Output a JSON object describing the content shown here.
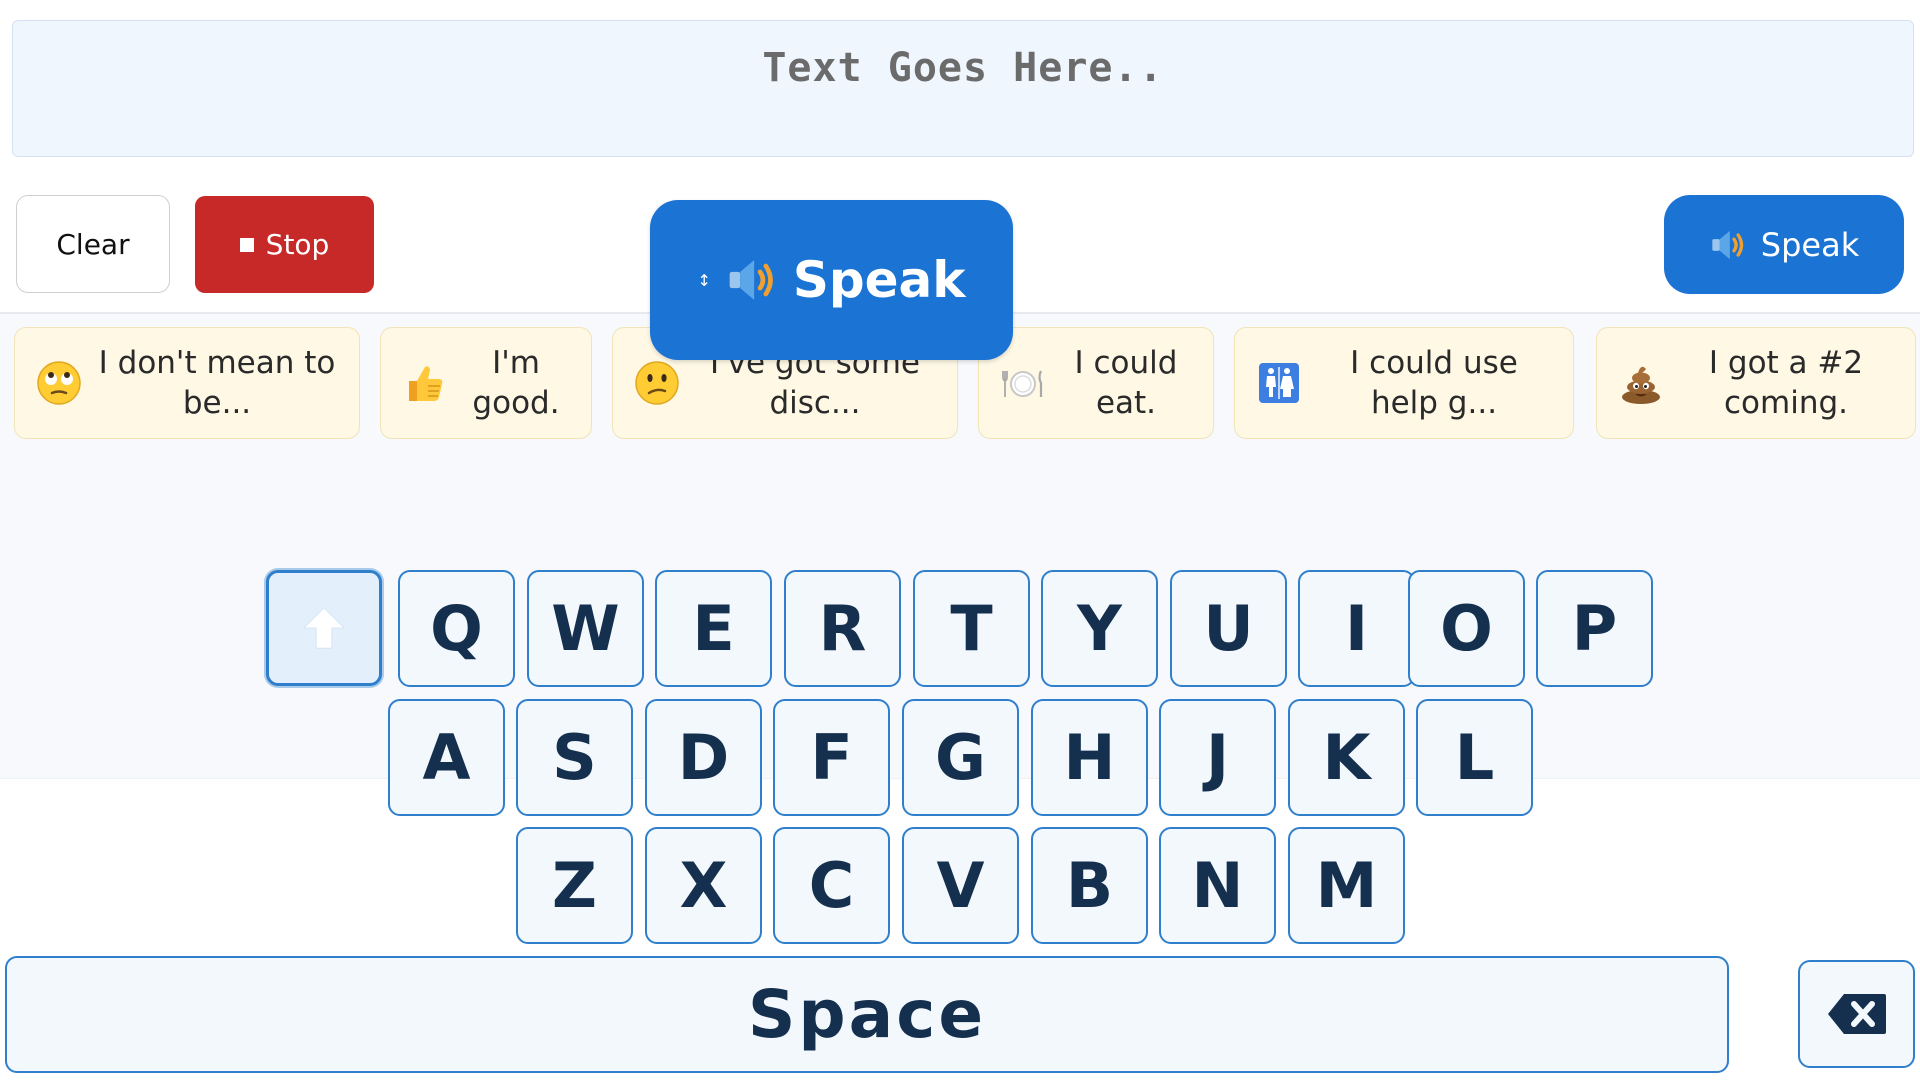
{
  "text_display": {
    "placeholder": "Text Goes Here.."
  },
  "controls": {
    "clear_label": "Clear",
    "stop_label": "Stop",
    "speak_float_label": "Speak",
    "speak_label": "Speak"
  },
  "phrases": [
    {
      "emoji": "eye-roll-emoji-icon",
      "text": "I don't mean to be..."
    },
    {
      "emoji": "thumbs-up-emoji-icon",
      "text": "I'm good."
    },
    {
      "emoji": "confused-face-emoji-icon",
      "text": "I've got some disc..."
    },
    {
      "emoji": "plate-cutlery-emoji-icon",
      "text": "I could eat."
    },
    {
      "emoji": "restroom-emoji-icon",
      "text": "I could use help g..."
    },
    {
      "emoji": "poop-emoji-icon",
      "text": "I got a #2 coming."
    }
  ],
  "keyboard": {
    "row1": [
      "Q",
      "W",
      "E",
      "R",
      "T",
      "Y",
      "U",
      "I",
      "O",
      "P"
    ],
    "row2": [
      "A",
      "S",
      "D",
      "F",
      "G",
      "H",
      "J",
      "K",
      "L"
    ],
    "row3": [
      "Z",
      "X",
      "C",
      "V",
      "B",
      "N",
      "M"
    ],
    "space_label": "Space",
    "shift_icon": "arrow-up-icon",
    "backspace_icon": "backspace-icon"
  },
  "colors": {
    "primary": "#1b73d3",
    "stop": "#c72828",
    "key_border": "#2f7fcc",
    "key_text": "#14304e",
    "phrase_bg": "#fef8e5"
  }
}
